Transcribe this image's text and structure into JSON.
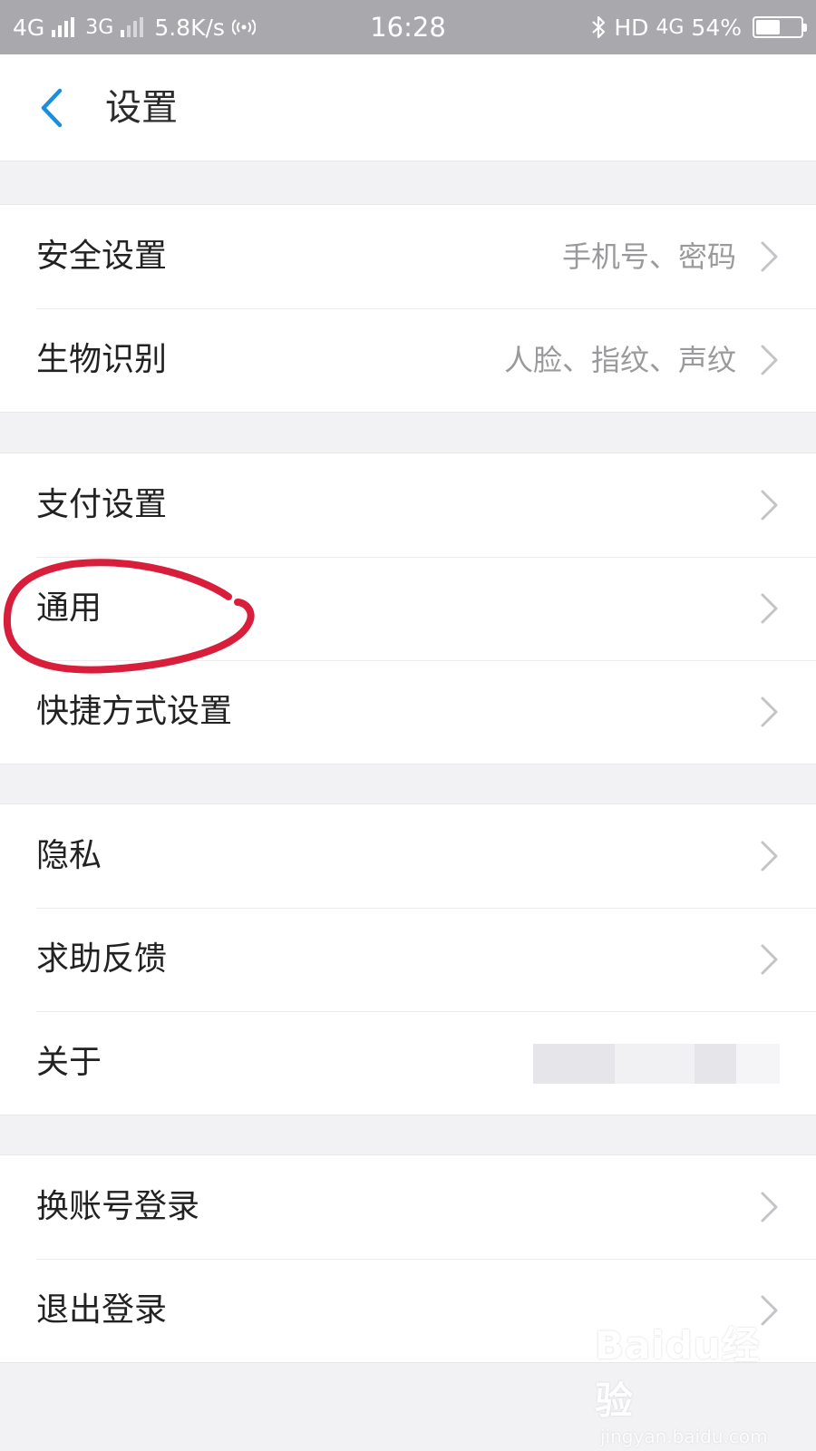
{
  "status_bar": {
    "network1": "4G",
    "network2": "3G",
    "speed": "5.8K/s",
    "time": "16:28",
    "hd": "HD",
    "network3": "4G",
    "battery_text": "54%",
    "battery_level": 0.54
  },
  "header": {
    "title": "设置",
    "back_icon": "chevron-left-icon"
  },
  "groups": [
    {
      "items": [
        {
          "label": "安全设置",
          "value": "手机号、密码"
        },
        {
          "label": "生物识别",
          "value": "人脸、指纹、声纹"
        }
      ]
    },
    {
      "items": [
        {
          "label": "支付设置",
          "value": ""
        },
        {
          "label": "通用",
          "value": ""
        },
        {
          "label": "快捷方式设置",
          "value": ""
        }
      ]
    },
    {
      "items": [
        {
          "label": "隐私",
          "value": ""
        },
        {
          "label": "求助反馈",
          "value": ""
        },
        {
          "label": "关于",
          "value": ""
        }
      ]
    },
    {
      "items": [
        {
          "label": "换账号登录",
          "value": ""
        },
        {
          "label": "退出登录",
          "value": ""
        }
      ]
    }
  ],
  "annotation": {
    "highlighted_item": "通用",
    "color": "#d81e3a"
  },
  "colors": {
    "accent": "#1a8fe0",
    "status_bar": "#a9a8ad",
    "background": "#f2f2f5"
  },
  "watermark": {
    "logo": "Baidu经验",
    "url": "jingyan.baidu.com"
  }
}
